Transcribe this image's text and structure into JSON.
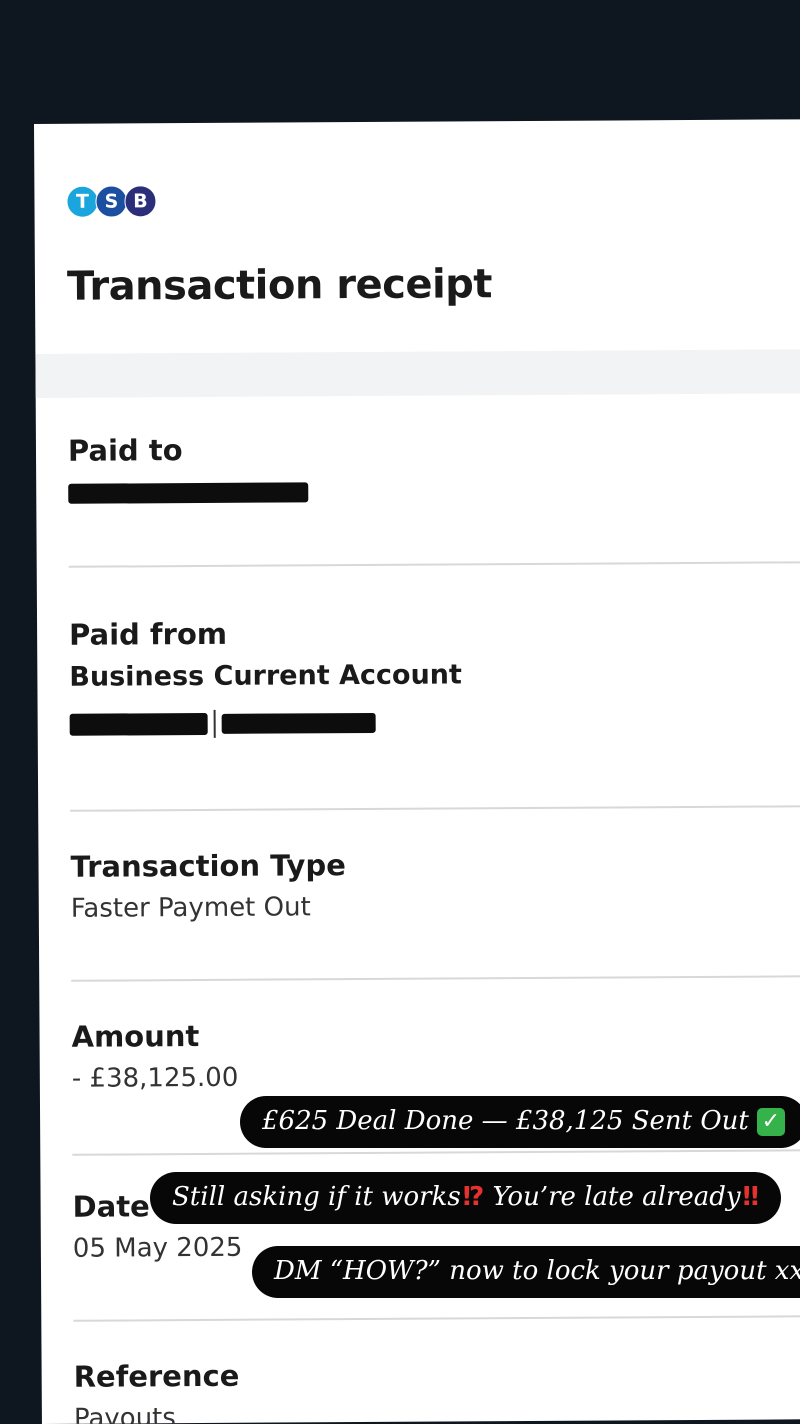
{
  "logo": {
    "letters": [
      "T",
      "S",
      "B"
    ]
  },
  "title": "Transaction receipt",
  "paid_to": {
    "label": "Paid to",
    "value_redacted": true
  },
  "paid_from": {
    "label": "Paid from",
    "account_name": "Business Current Account",
    "account_details_redacted": true
  },
  "transaction_type": {
    "label": "Transaction Type",
    "value": "Faster Paymet Out"
  },
  "amount": {
    "label": "Amount",
    "value": "- £38,125.00"
  },
  "date": {
    "label": "Date",
    "value": "05 May 2025"
  },
  "reference": {
    "label": "Reference",
    "value": "Payouts"
  },
  "overlays": {
    "line1": "£625 Deal Done — £38,125 Sent Out",
    "line1_emoji": "✓",
    "line2": "Still asking if it works",
    "line2_emoji_a": "⁉",
    "line2_mid": " You’re late already",
    "line2_emoji_b": "‼",
    "line3": "DM “HOW?” now to lock your payout xx"
  },
  "colors": {
    "background": "#0e1620",
    "tsb_t": "#1aa6dc",
    "tsb_s": "#1d4fa0",
    "tsb_b": "#2b2f7a",
    "check": "#36b24a",
    "alert_red": "#e5322e"
  }
}
